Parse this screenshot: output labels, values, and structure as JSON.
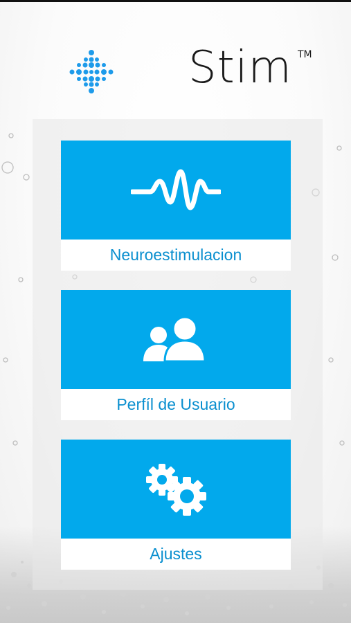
{
  "brand": {
    "name": "Stim",
    "trademark": "TM",
    "logo_icon": "dots-helix-icon"
  },
  "menu": {
    "items": [
      {
        "label": "Neuroestimulacion",
        "icon": "waveform-icon"
      },
      {
        "label": "Perfíl de Usuario",
        "icon": "users-icon"
      },
      {
        "label": "Ajustes",
        "icon": "gears-icon"
      }
    ]
  },
  "colors": {
    "accent": "#02a9ec",
    "label_text": "#0a8fcf",
    "brand_text": "#1a1a1a"
  }
}
